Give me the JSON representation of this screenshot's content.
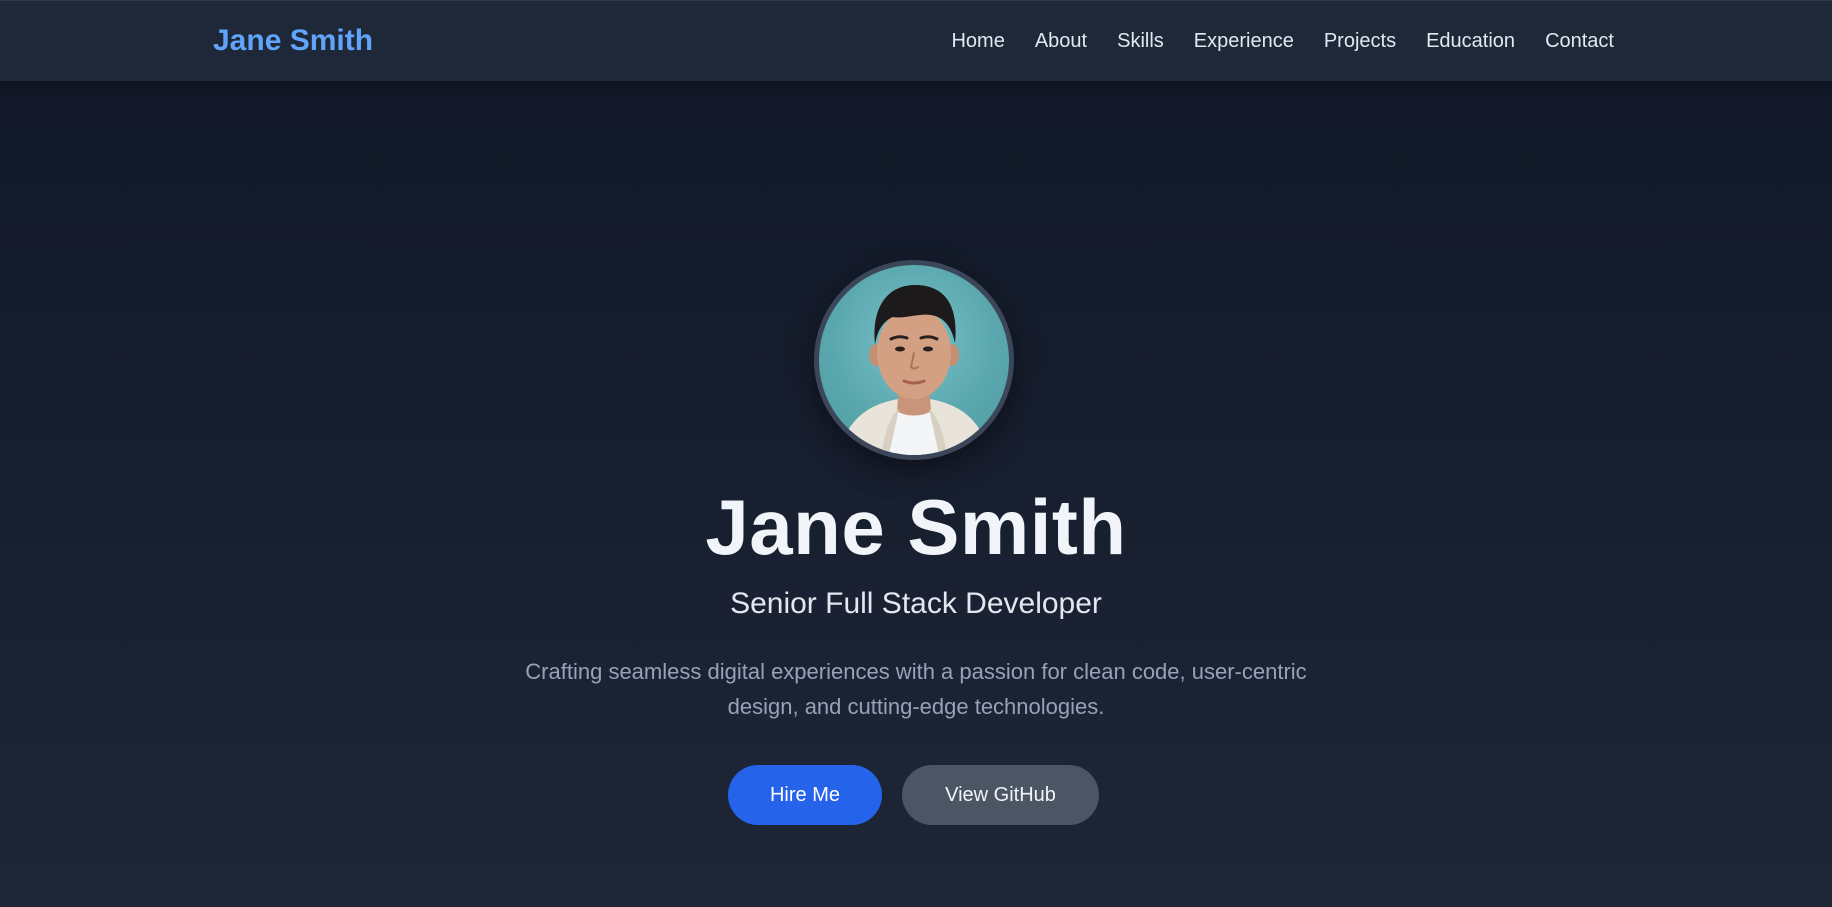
{
  "header": {
    "brand": "Jane Smith",
    "nav": [
      {
        "label": "Home"
      },
      {
        "label": "About"
      },
      {
        "label": "Skills"
      },
      {
        "label": "Experience"
      },
      {
        "label": "Projects"
      },
      {
        "label": "Education"
      },
      {
        "label": "Contact"
      }
    ]
  },
  "hero": {
    "avatar_alt": "profile-photo",
    "name": "Jane Smith",
    "title": "Senior Full Stack Developer",
    "description": "Crafting seamless digital experiences with a passion for clean code, user-centric design, and cutting-edge technologies.",
    "primary_button": "Hire Me",
    "secondary_button": "View GitHub"
  },
  "colors": {
    "accent": "#60a5fa",
    "primary_button": "#2563eb",
    "secondary_button": "#4b5563",
    "navbar_bg": "#1f2838",
    "hero_bg_top": "#111827",
    "hero_bg_bottom": "#1e2638"
  }
}
